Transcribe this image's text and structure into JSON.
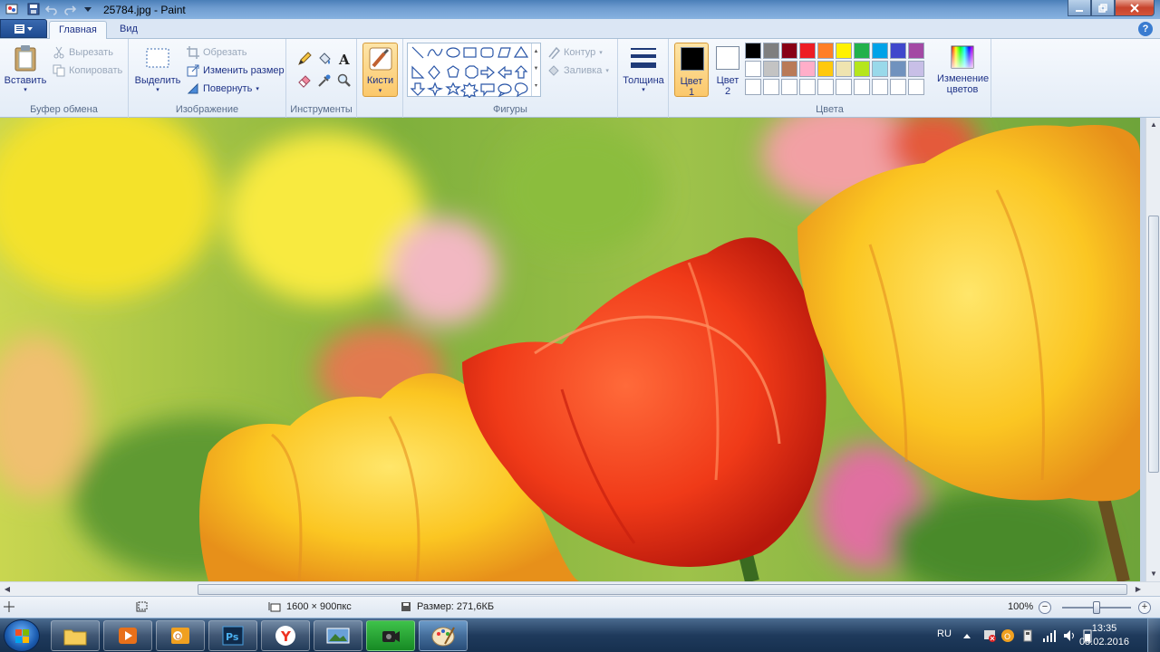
{
  "window": {
    "title": "25784.jpg - Paint"
  },
  "tabs": {
    "home": "Главная",
    "view": "Вид"
  },
  "ribbon": {
    "clipboard": {
      "label": "Буфер обмена",
      "paste": "Вставить",
      "cut": "Вырезать",
      "copy": "Копировать"
    },
    "image": {
      "label": "Изображение",
      "select": "Выделить",
      "crop": "Обрезать",
      "resize": "Изменить размер",
      "rotate": "Повернуть"
    },
    "tools": {
      "label": "Инструменты"
    },
    "brushes": "Кисти",
    "shapes": {
      "label": "Фигуры",
      "outline": "Контур",
      "fill": "Заливка"
    },
    "size": "Толщина",
    "colors": {
      "label": "Цвета",
      "color1_line1": "Цвет",
      "color1_line2": "1",
      "color2_line1": "Цвет",
      "color2_line2": "2",
      "edit_line1": "Изменение",
      "edit_line2": "цветов",
      "color1_value": "#000000",
      "color2_value": "#ffffff",
      "palette_row1": [
        "#000000",
        "#7f7f7f",
        "#880015",
        "#ed1c24",
        "#ff7f27",
        "#fff200",
        "#22b14c",
        "#00a2e8",
        "#3f48cc",
        "#a349a4"
      ],
      "palette_row2": [
        "#ffffff",
        "#c3c3c3",
        "#b97a57",
        "#ffaec9",
        "#ffc90e",
        "#efe4b0",
        "#b5e61d",
        "#99d9ea",
        "#7092be",
        "#c8bfe7"
      ],
      "palette_row3": [
        "#ffffff",
        "#ffffff",
        "#ffffff",
        "#ffffff",
        "#ffffff",
        "#ffffff",
        "#ffffff",
        "#ffffff",
        "#ffffff",
        "#ffffff"
      ]
    }
  },
  "status": {
    "dimensions": "1600 × 900пкс",
    "size": "Размер: 271,6КБ",
    "zoom": "100%"
  },
  "taskbar": {
    "lang": "RU",
    "time": "13:35",
    "date": "05.02.2016"
  }
}
